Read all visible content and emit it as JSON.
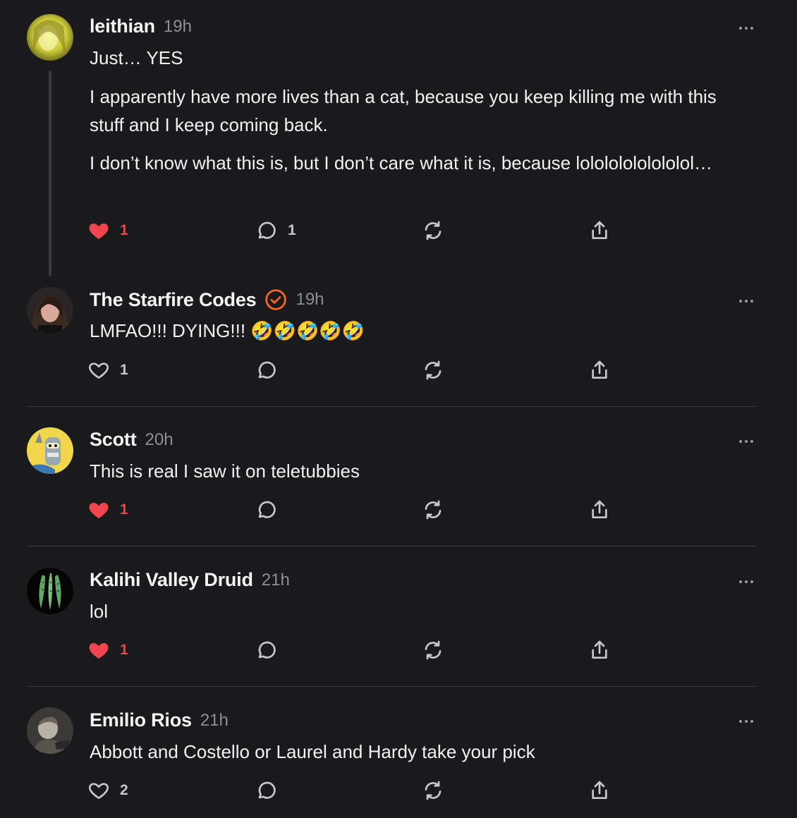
{
  "comments": [
    {
      "username": "leithian",
      "time": "19h",
      "paragraphs": [
        "Just… YES",
        "I apparently have more lives than a cat, because you keep killing me with this stuff and I keep coming back.",
        "I don’t know what this is, but I don’t care what it is, because lolololololololol…"
      ],
      "likes": "1",
      "liked": true,
      "replies": "1"
    },
    {
      "username": "The Starfire Codes",
      "verified": true,
      "time": "19h",
      "paragraphs": [
        "LMFAO!!! DYING!!! 🤣🤣🤣🤣🤣"
      ],
      "likes": "1",
      "liked": false,
      "replies": ""
    },
    {
      "username": "Scott",
      "time": "20h",
      "paragraphs": [
        "This is real I saw it on teletubbies"
      ],
      "likes": "1",
      "liked": true,
      "replies": ""
    },
    {
      "username": "Kalihi Valley Druid",
      "time": "21h",
      "paragraphs": [
        "lol"
      ],
      "likes": "1",
      "liked": true,
      "replies": ""
    },
    {
      "username": "Emilio Rios",
      "time": "21h",
      "paragraphs": [
        "Abbott and Costello or Laurel and Hardy take your pick"
      ],
      "likes": "2",
      "liked": false,
      "replies": ""
    }
  ],
  "colors": {
    "background": "#1a1a1c",
    "like_active": "#f0444f",
    "verified": "#ff6b1a"
  },
  "icons": {
    "like": "heart-icon",
    "reply": "comment-bubble-icon",
    "restack": "restack-icon",
    "share": "share-icon",
    "more": "more-dots-icon",
    "verified": "verified-check-icon"
  }
}
